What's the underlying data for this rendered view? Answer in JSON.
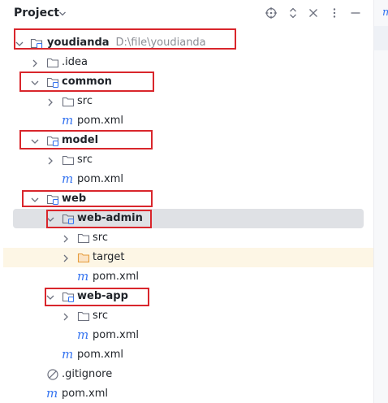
{
  "header": {
    "title": "Project",
    "icons": [
      "crosshair-icon",
      "expand-collapse-icon",
      "more-icon",
      "minimize-icon"
    ]
  },
  "tree": {
    "root_name": "youdianda",
    "root_path": "D:\\file\\youdianda",
    "idea": ".idea",
    "common": "common",
    "common_src": "src",
    "common_pom": "pom.xml",
    "model": "model",
    "model_src": "src",
    "model_pom": "pom.xml",
    "web": "web",
    "web_admin": "web-admin",
    "web_admin_src": "src",
    "web_admin_target": "target",
    "web_admin_pom": "pom.xml",
    "web_app": "web-app",
    "web_app_src": "src",
    "web_app_pom": "pom.xml",
    "web_pom": "pom.xml",
    "gitignore": ".gitignore",
    "root_pom": "pom.xml"
  },
  "colors": {
    "maven_icon": "#3574f0",
    "highlight_box": "#d9262c",
    "selected_row": "#dfe1e5",
    "excluded_row": "#fdf6e5",
    "excluded_folder": "#e59b3a"
  }
}
